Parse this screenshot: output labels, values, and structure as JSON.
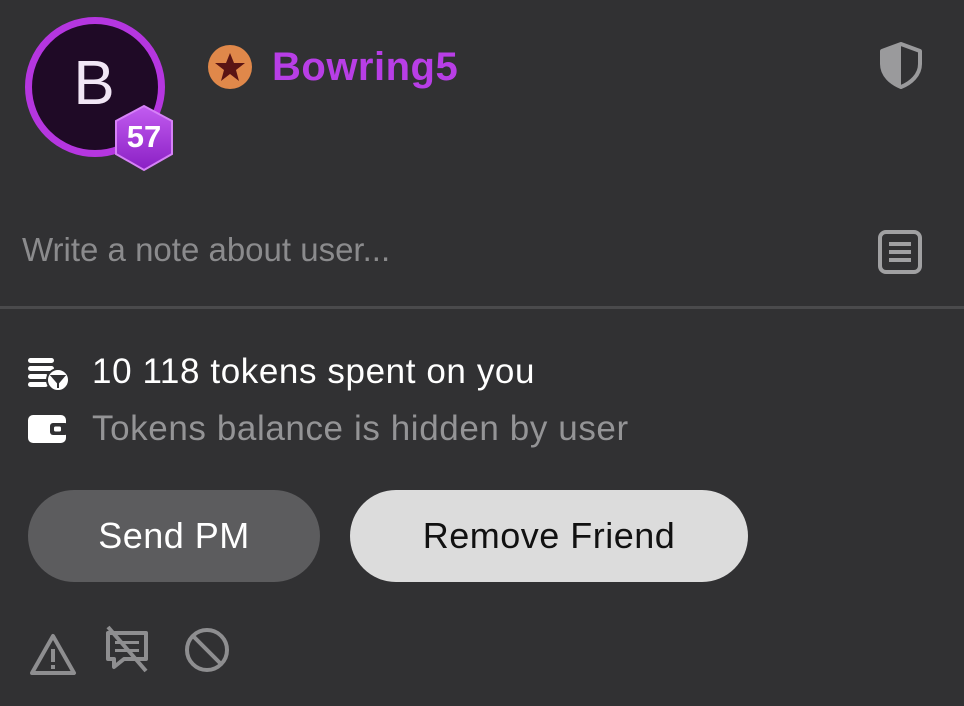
{
  "user": {
    "avatar_letter": "B",
    "level": "57",
    "username": "Bowring5",
    "rank_icon": "star-rank-icon",
    "colors": {
      "username": "#b83ee6",
      "avatar_ring": "#b536e0",
      "rank_badge": "#e0884a"
    }
  },
  "note": {
    "placeholder": "Write a note about user...",
    "value": ""
  },
  "stats": {
    "spent_text": "10 118 tokens spent on you",
    "balance_text": "Tokens balance is hidden by user"
  },
  "buttons": {
    "send_pm": "Send PM",
    "remove_friend": "Remove Friend"
  },
  "actions": {
    "report_icon": "warning-icon",
    "mute_icon": "mute-chat-icon",
    "block_icon": "block-icon",
    "shield_icon": "shield-icon",
    "note_icon": "note-icon"
  }
}
